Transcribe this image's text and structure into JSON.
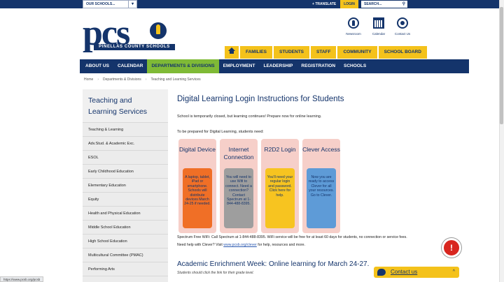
{
  "topbar": {
    "schools_select": "OUR SCHOOLS...",
    "translate": "TRANSLATE",
    "login": "LOGIN",
    "search_placeholder": "SEARCH..."
  },
  "logo": {
    "text": "pcs",
    "county": "PINELLAS COUNTY SCHOOLS"
  },
  "quick_links": {
    "newsroom": "Newsroom",
    "calendar": "Calendar",
    "contact": "Contact Us"
  },
  "gold_tabs": [
    "FAMILIES",
    "STUDENTS",
    "STAFF",
    "COMMUNITY",
    "SCHOOL BOARD"
  ],
  "main_nav": [
    "ABOUT US",
    "CALENDAR",
    "DEPARTMENTS & DIVISIONS",
    "EMPLOYMENT",
    "LEADERSHIP",
    "REGISTRATION",
    "SCHOOLS"
  ],
  "breadcrumb": [
    "Home",
    "Departments & Divisions",
    "Teaching and Learning Services"
  ],
  "sidebar": {
    "title": "Teaching and Learning Services",
    "items": [
      "Teaching & Learning",
      "Adv.Stud. & Academic Exc.",
      "ESOL",
      "Early Childhood Education",
      "Elementary Education",
      "Equity",
      "Health and Physical Education",
      "Middle School Education",
      "High School Education",
      "Multicultural Committee (PMAC)",
      "Performing Arts"
    ]
  },
  "main": {
    "heading": "Digital Learning Login Instructions for Students",
    "intro": "School is temporarily closed, but learning continues!  Prepare now for online learning.",
    "prep": "To be prepared for Digital Learning, students need:",
    "cards": [
      {
        "title": "Digital Device",
        "body": "A laptop, tablet, iPad or smartphone. Schools will distribute devices March 24-25 if needed."
      },
      {
        "title": "Internet Connection",
        "body": "You will need to use Wifi to connect. Need a connection? Contact Spectrum at 1-844-488-8395."
      },
      {
        "title": "R2D2 Login",
        "body": "You'll need your regular login and password. Click here for help."
      },
      {
        "title": "Clever Access",
        "body": "Now you are ready to access Clever for all your resources. Go to Clever."
      }
    ],
    "wifi_note": "Spectrum Free WiFi: Call Spectrum at 1-844-488-8395.  WiFi service will be free for at least 60 days for students, no connection or service fees.",
    "clever_pre": "Need help with Clever? Visit ",
    "clever_link": "www.pcsb.org/clever",
    "clever_post": " for help, resources and more.",
    "enrichment_heading": "Academic Enrichment Week: Online learning for March 24-27.",
    "enrichment_sub": "Students should click the link for their grade level."
  },
  "alert_glyph": "!",
  "contact_bar": {
    "label": "Contact us",
    "chevron": "^"
  },
  "status_url": "https://www.pcsb.org/pcsb"
}
